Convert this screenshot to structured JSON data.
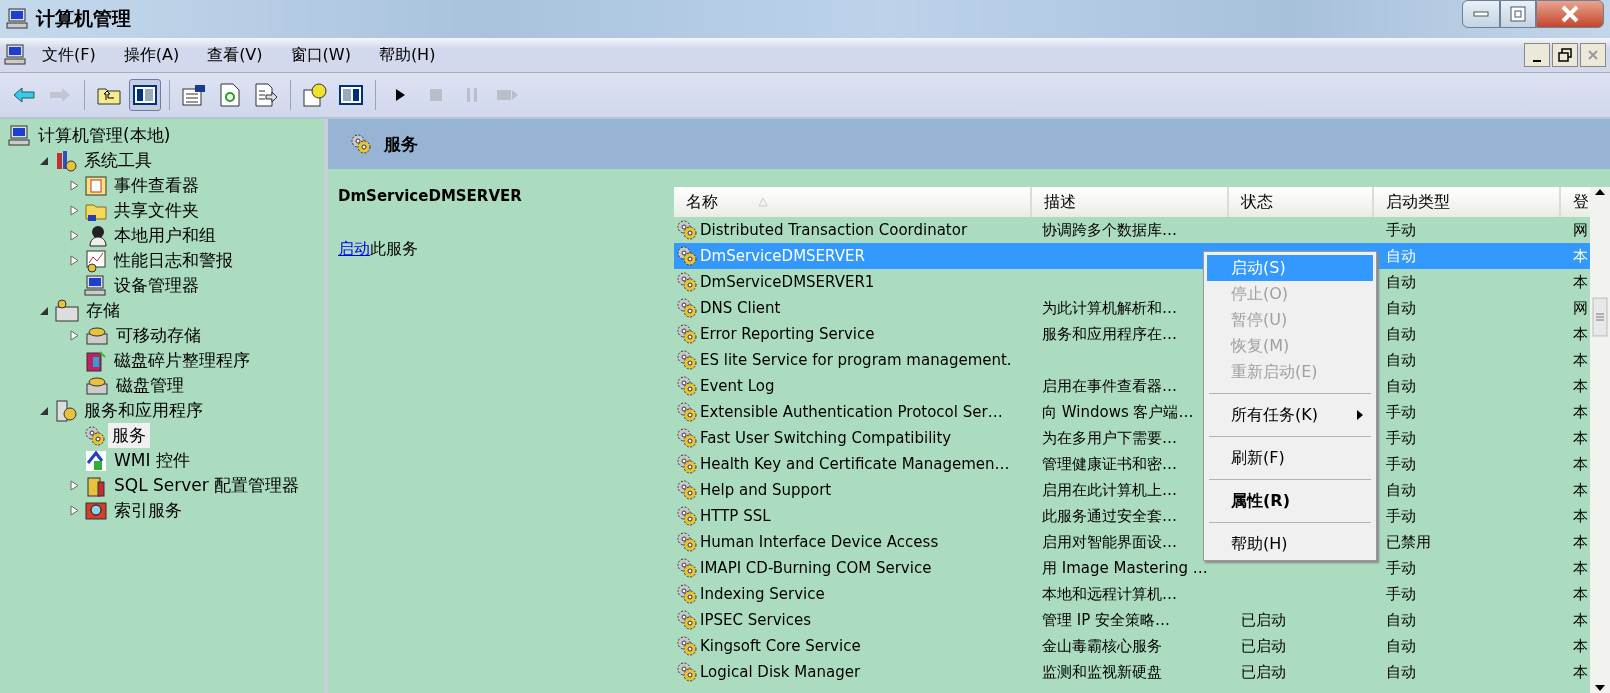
{
  "window": {
    "title": "计算机管理"
  },
  "menu_bar": [
    {
      "label": "文件(F)"
    },
    {
      "label": "操作(A)"
    },
    {
      "label": "查看(V)"
    },
    {
      "label": "窗口(W)"
    },
    {
      "label": "帮助(H)"
    }
  ],
  "toolbar": [
    {
      "kind": "back",
      "disabled": false,
      "pressed": false
    },
    {
      "kind": "forward",
      "disabled": true,
      "pressed": false
    },
    {
      "kind": "sep"
    },
    {
      "kind": "up",
      "disabled": false,
      "pressed": false
    },
    {
      "kind": "tree",
      "disabled": false,
      "pressed": true
    },
    {
      "kind": "sep"
    },
    {
      "kind": "properties",
      "disabled": false,
      "pressed": false
    },
    {
      "kind": "refresh",
      "disabled": false,
      "pressed": false
    },
    {
      "kind": "export",
      "disabled": false,
      "pressed": false
    },
    {
      "kind": "sep"
    },
    {
      "kind": "help",
      "disabled": false,
      "pressed": false
    },
    {
      "kind": "pane",
      "disabled": false,
      "pressed": false
    },
    {
      "kind": "sep"
    },
    {
      "kind": "play",
      "disabled": false,
      "pressed": false
    },
    {
      "kind": "stop",
      "disabled": true,
      "pressed": false
    },
    {
      "kind": "pause",
      "disabled": true,
      "pressed": false
    },
    {
      "kind": "resume",
      "disabled": true,
      "pressed": false
    }
  ],
  "tree": {
    "label": "计算机管理(本地)",
    "kind": "computer",
    "selected": false,
    "children": [
      {
        "label": "系统工具",
        "kind": "tools",
        "expanded": true,
        "selected": false,
        "children": [
          {
            "label": "事件查看器",
            "kind": "log",
            "expanded": false,
            "selected": false,
            "has_children": true
          },
          {
            "label": "共享文件夹",
            "kind": "folder",
            "expanded": false,
            "selected": false,
            "has_children": true
          },
          {
            "label": "本地用户和组",
            "kind": "users",
            "expanded": false,
            "selected": false,
            "has_children": true
          },
          {
            "label": "性能日志和警报",
            "kind": "chart",
            "expanded": false,
            "selected": false,
            "has_children": true
          },
          {
            "label": "设备管理器",
            "kind": "computer",
            "selected": false,
            "has_children": false
          }
        ]
      },
      {
        "label": "存储",
        "kind": "storage",
        "expanded": true,
        "selected": false,
        "children": [
          {
            "label": "可移动存储",
            "kind": "disk",
            "expanded": false,
            "selected": false,
            "has_children": true
          },
          {
            "label": "磁盘碎片整理程序",
            "kind": "defrag",
            "selected": false,
            "has_children": false
          },
          {
            "label": "磁盘管理",
            "kind": "disk",
            "selected": false,
            "has_children": false
          }
        ]
      },
      {
        "label": "服务和应用程序",
        "kind": "server",
        "expanded": true,
        "selected": false,
        "children": [
          {
            "label": "服务",
            "kind": "gears",
            "selected": true,
            "has_children": false
          },
          {
            "label": "WMI 控件",
            "kind": "wmi",
            "selected": false,
            "has_children": false
          },
          {
            "label": "SQL Server 配置管理器",
            "kind": "sql",
            "expanded": false,
            "selected": false,
            "has_children": true
          },
          {
            "label": "索引服务",
            "kind": "search",
            "expanded": false,
            "selected": false,
            "has_children": true
          }
        ]
      }
    ]
  },
  "pane_header": {
    "title": "服务"
  },
  "taskpad": {
    "service_name": "DmServiceDMSERVER",
    "link": "启动",
    "link_suffix": "此服务"
  },
  "table": {
    "columns": [
      {
        "label": "名称",
        "sorted": true
      },
      {
        "label": "描述"
      },
      {
        "label": "状态"
      },
      {
        "label": "启动类型"
      },
      {
        "label": "登"
      }
    ],
    "rows": [
      {
        "name": "Distributed Transaction Coordinator",
        "description": "协调跨多个数据库…",
        "status": "",
        "startup_type": "手动",
        "column_5": "网",
        "selected": false
      },
      {
        "name": "DmServiceDMSERVER",
        "description": "",
        "status": "",
        "startup_type": "自动",
        "column_5": "本",
        "selected": true
      },
      {
        "name": "DmServiceDMSERVER1",
        "description": "",
        "status": "",
        "startup_type": "自动",
        "column_5": "本",
        "selected": false
      },
      {
        "name": "DNS Client",
        "description": "为此计算机解析和…",
        "status": "",
        "startup_type": "自动",
        "column_5": "网",
        "selected": false
      },
      {
        "name": "Error Reporting Service",
        "description": "服务和应用程序在…",
        "status": "",
        "startup_type": "自动",
        "column_5": "本",
        "selected": false
      },
      {
        "name": "ES lite Service for program management.",
        "description": "",
        "status": "",
        "startup_type": "自动",
        "column_5": "本",
        "selected": false
      },
      {
        "name": "Event Log",
        "description": "启用在事件查看器…",
        "status": "",
        "startup_type": "自动",
        "column_5": "本",
        "selected": false
      },
      {
        "name": "Extensible Authentication Protocol Ser…",
        "description": "向 Windows 客户端…",
        "status": "",
        "startup_type": "手动",
        "column_5": "本",
        "selected": false
      },
      {
        "name": "Fast User Switching Compatibility",
        "description": "为在多用户下需要…",
        "status": "",
        "startup_type": "手动",
        "column_5": "本",
        "selected": false
      },
      {
        "name": "Health Key and Certificate Managemen…",
        "description": "管理健康证书和密…",
        "status": "",
        "startup_type": "手动",
        "column_5": "本",
        "selected": false
      },
      {
        "name": "Help and Support",
        "description": "启用在此计算机上…",
        "status": "",
        "startup_type": "自动",
        "column_5": "本",
        "selected": false
      },
      {
        "name": "HTTP SSL",
        "description": "此服务通过安全套…",
        "status": "",
        "startup_type": "手动",
        "column_5": "本",
        "selected": false
      },
      {
        "name": "Human Interface Device Access",
        "description": "启用对智能界面设…",
        "status": "",
        "startup_type": "已禁用",
        "column_5": "本",
        "selected": false
      },
      {
        "name": "IMAPI CD-Burning COM Service",
        "description": "用 Image Mastering …",
        "status": "",
        "startup_type": "手动",
        "column_5": "本",
        "selected": false
      },
      {
        "name": "Indexing Service",
        "description": "本地和远程计算机…",
        "status": "",
        "startup_type": "手动",
        "column_5": "本",
        "selected": false
      },
      {
        "name": "IPSEC Services",
        "description": "管理 IP 安全策略…",
        "status": "已启动",
        "startup_type": "自动",
        "column_5": "本",
        "selected": false
      },
      {
        "name": "Kingsoft Core Service",
        "description": "金山毒霸核心服务",
        "status": "已启动",
        "startup_type": "自动",
        "column_5": "本",
        "selected": false
      },
      {
        "name": "Logical Disk Manager",
        "description": "监测和监视新硬盘",
        "status": "已启动",
        "startup_type": "自动",
        "column_5": "本",
        "selected": false
      }
    ]
  },
  "context_menu": [
    {
      "kind": "item",
      "label": "启动(S)",
      "disabled": false,
      "selected": true,
      "bold": false
    },
    {
      "kind": "item",
      "label": "停止(O)",
      "disabled": true,
      "selected": false,
      "bold": false
    },
    {
      "kind": "item",
      "label": "暂停(U)",
      "disabled": true,
      "selected": false,
      "bold": false
    },
    {
      "kind": "item",
      "label": "恢复(M)",
      "disabled": true,
      "selected": false,
      "bold": false
    },
    {
      "kind": "item",
      "label": "重新启动(E)",
      "disabled": true,
      "selected": false,
      "bold": false
    },
    {
      "kind": "separator"
    },
    {
      "kind": "submenu",
      "label": "所有任务(K)",
      "disabled": false,
      "selected": false,
      "bold": false
    },
    {
      "kind": "separator"
    },
    {
      "kind": "item",
      "label": "刷新(F)",
      "disabled": false,
      "selected": false,
      "bold": false
    },
    {
      "kind": "separator"
    },
    {
      "kind": "item",
      "label": "属性(R)",
      "disabled": false,
      "selected": false,
      "bold": true
    },
    {
      "kind": "separator"
    },
    {
      "kind": "item",
      "label": "帮助(H)",
      "disabled": false,
      "selected": false,
      "bold": false
    }
  ]
}
